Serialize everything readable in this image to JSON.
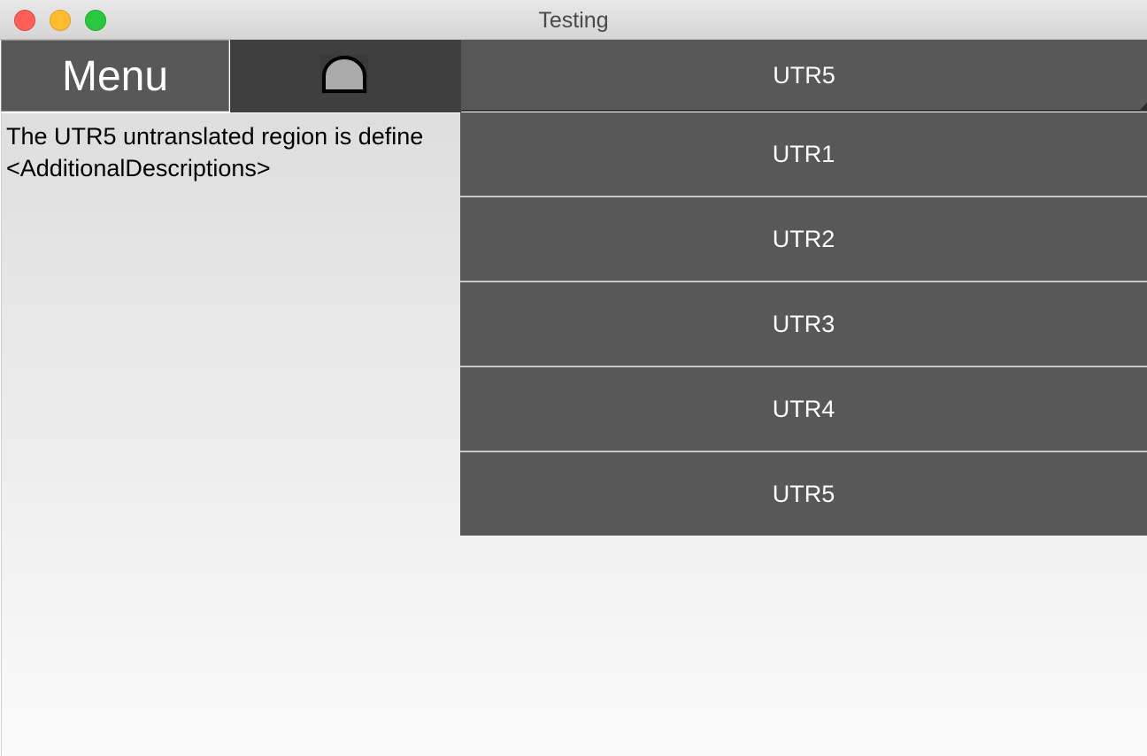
{
  "window": {
    "title": "Testing"
  },
  "toolbar": {
    "menu_label": "Menu",
    "icon": "dome-icon"
  },
  "dropdown": {
    "selected": "UTR5",
    "options": [
      "UTR1",
      "UTR2",
      "UTR3",
      "UTR4",
      "UTR5"
    ]
  },
  "content": {
    "description_line1": "The UTR5 untranslated region is define",
    "description_line2": "<AdditionalDescriptions>"
  },
  "colors": {
    "button_bg": "#585858",
    "icon_cell_bg": "#3f3f3f",
    "close": "#fe5f57",
    "minimize": "#febc2e",
    "maximize": "#28c840"
  }
}
